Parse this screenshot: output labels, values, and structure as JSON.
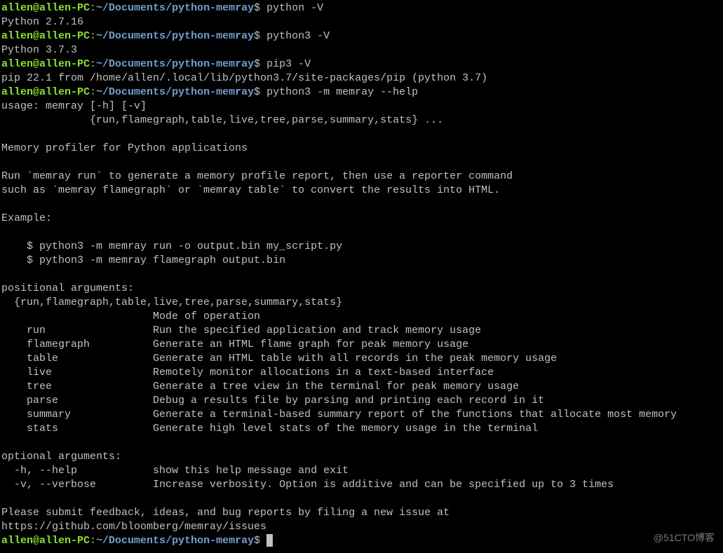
{
  "prompt": {
    "user_host": "allen@allen-PC",
    "colon": ":",
    "path": "~/Documents/python-memray",
    "dollar": "$"
  },
  "lines": [
    {
      "type": "prompt",
      "cmd": " python -V"
    },
    {
      "type": "out",
      "text": "Python 2.7.16"
    },
    {
      "type": "prompt",
      "cmd": " python3 -V"
    },
    {
      "type": "out",
      "text": "Python 3.7.3"
    },
    {
      "type": "prompt",
      "cmd": " pip3 -V"
    },
    {
      "type": "out",
      "text": "pip 22.1 from /home/allen/.local/lib/python3.7/site-packages/pip (python 3.7)"
    },
    {
      "type": "prompt",
      "cmd": " python3 -m memray --help"
    },
    {
      "type": "out",
      "text": "usage: memray [-h] [-v]"
    },
    {
      "type": "out",
      "text": "              {run,flamegraph,table,live,tree,parse,summary,stats} ..."
    },
    {
      "type": "out",
      "text": ""
    },
    {
      "type": "out",
      "text": "Memory profiler for Python applications"
    },
    {
      "type": "out",
      "text": ""
    },
    {
      "type": "out",
      "text": "Run `memray run` to generate a memory profile report, then use a reporter command"
    },
    {
      "type": "out",
      "text": "such as `memray flamegraph` or `memray table` to convert the results into HTML."
    },
    {
      "type": "out",
      "text": ""
    },
    {
      "type": "out",
      "text": "Example:"
    },
    {
      "type": "out",
      "text": ""
    },
    {
      "type": "out",
      "text": "    $ python3 -m memray run -o output.bin my_script.py"
    },
    {
      "type": "out",
      "text": "    $ python3 -m memray flamegraph output.bin"
    },
    {
      "type": "out",
      "text": ""
    },
    {
      "type": "out",
      "text": "positional arguments:"
    },
    {
      "type": "out",
      "text": "  {run,flamegraph,table,live,tree,parse,summary,stats}"
    },
    {
      "type": "out",
      "text": "                        Mode of operation"
    },
    {
      "type": "out",
      "text": "    run                 Run the specified application and track memory usage"
    },
    {
      "type": "out",
      "text": "    flamegraph          Generate an HTML flame graph for peak memory usage"
    },
    {
      "type": "out",
      "text": "    table               Generate an HTML table with all records in the peak memory usage"
    },
    {
      "type": "out",
      "text": "    live                Remotely monitor allocations in a text-based interface"
    },
    {
      "type": "out",
      "text": "    tree                Generate a tree view in the terminal for peak memory usage"
    },
    {
      "type": "out",
      "text": "    parse               Debug a results file by parsing and printing each record in it"
    },
    {
      "type": "out",
      "text": "    summary             Generate a terminal-based summary report of the functions that allocate most memory"
    },
    {
      "type": "out",
      "text": "    stats               Generate high level stats of the memory usage in the terminal"
    },
    {
      "type": "out",
      "text": ""
    },
    {
      "type": "out",
      "text": "optional arguments:"
    },
    {
      "type": "out",
      "text": "  -h, --help            show this help message and exit"
    },
    {
      "type": "out",
      "text": "  -v, --verbose         Increase verbosity. Option is additive and can be specified up to 3 times"
    },
    {
      "type": "out",
      "text": ""
    },
    {
      "type": "out",
      "text": "Please submit feedback, ideas, and bug reports by filing a new issue at"
    },
    {
      "type": "out",
      "text": "https://github.com/bloomberg/memray/issues"
    },
    {
      "type": "prompt_cursor",
      "cmd": " "
    }
  ],
  "watermark": "@51CTO博客"
}
